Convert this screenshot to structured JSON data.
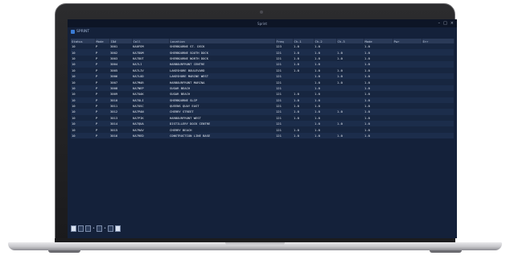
{
  "window": {
    "title": "Sprint",
    "app_label": "SPRINT",
    "controls": [
      "–",
      "□",
      "×"
    ]
  },
  "table": {
    "columns": [
      "Status",
      "Mode",
      "ID#",
      "Call",
      "Location",
      "Freq",
      "Ch-1",
      "Ch-2",
      "Ch-3",
      "Mode",
      "Pwr",
      "Err"
    ],
    "rows": [
      [
        "10",
        "P",
        "3001",
        "KA0FEM",
        "SHERBOURNE ST. DECK",
        "123",
        "1.0",
        "1.0",
        "",
        "1.0",
        ""
      ],
      [
        "10",
        "P",
        "3002",
        "KA7DUM",
        "SHERBOURNE SOUTH DOCK",
        "121",
        "1.0",
        "1.0",
        "1.0",
        "1.0",
        ""
      ],
      [
        "10",
        "P",
        "3003",
        "KA7DUT",
        "SHERBOURNE NORTH DOCK",
        "121",
        "1.0",
        "1.0",
        "1.0",
        "1.0",
        ""
      ],
      [
        "10",
        "P",
        "3004",
        "KA7LI",
        "HARBOURFRONT CENTRE",
        "121",
        "1.0",
        "1.0",
        "",
        "1.0",
        ""
      ],
      [
        "10",
        "P",
        "3005",
        "KA7LIV",
        "LAKESHORE BOULEVARD",
        "121",
        "1.0",
        "1.0",
        "1.0",
        "1.0",
        ""
      ],
      [
        "10",
        "P",
        "3006",
        "KA7LOD",
        "LAKESHORE MARINE WEST",
        "121",
        "",
        "1.0",
        "1.0",
        "1.0",
        ""
      ],
      [
        "10",
        "P",
        "3007",
        "KA7MAR",
        "HARBOURFRONT MARINA",
        "121",
        "",
        "1.0",
        "1.0",
        "1.0",
        ""
      ],
      [
        "10",
        "P",
        "3008",
        "KA7NEP",
        "SUGAR BEACH",
        "121",
        "",
        "1.0",
        "",
        "1.0",
        ""
      ],
      [
        "10",
        "P",
        "3009",
        "KA7OAK",
        "SUGAR BEACH",
        "121",
        "1.0",
        "1.0",
        "",
        "1.0",
        ""
      ],
      [
        "10",
        "P",
        "3010",
        "KA7OLI",
        "SHERBOURNE SLIP",
        "121",
        "1.0",
        "1.0",
        "",
        "1.0",
        ""
      ],
      [
        "10",
        "P",
        "3011",
        "KA7OSC",
        "QUEENS QUAY EAST",
        "121",
        "1.0",
        "1.0",
        "",
        "1.0",
        ""
      ],
      [
        "10",
        "P",
        "3012",
        "KA7PAN",
        "CHERRY STREET",
        "121",
        "1.0",
        "1.0",
        "1.0",
        "1.0",
        ""
      ],
      [
        "10",
        "P",
        "3013",
        "KA7PIK",
        "HARBOURFRONT WEST",
        "121",
        "1.0",
        "1.0",
        "",
        "1.0",
        ""
      ],
      [
        "10",
        "P",
        "3014",
        "KA7QUA",
        "DISTILLERY DOCK CENTRE",
        "121",
        "",
        "1.0",
        "1.0",
        "1.0",
        ""
      ],
      [
        "10",
        "P",
        "3015",
        "KA7RAV",
        "CHERRY BEACH",
        "121",
        "1.0",
        "1.0",
        "",
        "1.0",
        ""
      ],
      [
        "10",
        "P",
        "3016",
        "KA7RED",
        "CONSTRUCTION LINE BASE",
        "121",
        "1.0",
        "1.0",
        "1.0",
        "1.0",
        ""
      ]
    ]
  },
  "statusbar": {
    "buttons": [
      "grid",
      "list",
      "filter",
      "sort",
      "page",
      "export"
    ],
    "separators": [
      "•",
      "•"
    ]
  },
  "colors": {
    "screen_bg": "#14213a",
    "header_bg": "#2a3a58",
    "value_green": "#7fe34a",
    "value_yellow": "#d4e34a"
  }
}
